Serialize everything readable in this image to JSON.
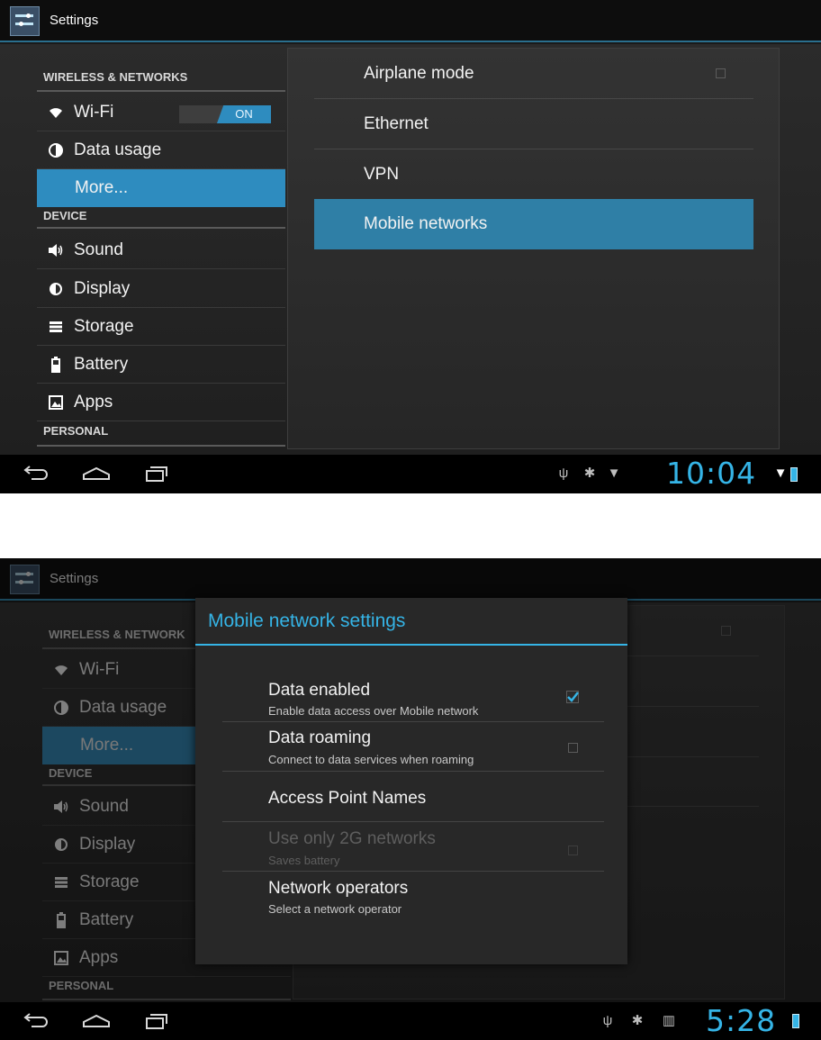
{
  "screen1": {
    "app_title": "Settings",
    "left": {
      "section_wireless": "WIRELESS & NETWORKS",
      "wifi_label": "Wi-Fi",
      "wifi_toggle": "ON",
      "data_usage": "Data usage",
      "more": "More...",
      "section_device": "DEVICE",
      "sound": "Sound",
      "display": "Display",
      "storage": "Storage",
      "battery": "Battery",
      "apps": "Apps",
      "section_personal": "PERSONAL"
    },
    "right": {
      "airplane": "Airplane mode",
      "ethernet": "Ethernet",
      "vpn": "VPN",
      "mobile": "Mobile networks"
    },
    "status": {
      "clock": "10:04"
    }
  },
  "screen2": {
    "app_title": "Settings",
    "left": {
      "section_wireless": "WIRELESS & NETWORK",
      "wifi_label": "Wi-Fi",
      "data_usage": "Data usage",
      "more": "More...",
      "section_device": "DEVICE",
      "sound": "Sound",
      "display": "Display",
      "storage": "Storage",
      "battery": "Battery",
      "apps": "Apps",
      "section_personal": "PERSONAL"
    },
    "dialog": {
      "title": "Mobile network settings",
      "items": [
        {
          "title": "Data enabled",
          "summary": "Enable data access over Mobile network",
          "checked": true
        },
        {
          "title": "Data roaming",
          "summary": "Connect to data services when roaming",
          "checked": false
        },
        {
          "title": "Access Point Names",
          "summary": ""
        },
        {
          "title": "Use only 2G networks",
          "summary": "Saves battery",
          "checked": false,
          "enabled": false
        },
        {
          "title": "Network operators",
          "summary": "Select a network operator"
        }
      ]
    },
    "status": {
      "clock": "5:28"
    }
  },
  "colors": {
    "accent": "#35b4e6",
    "selection": "#2e8cbf"
  }
}
